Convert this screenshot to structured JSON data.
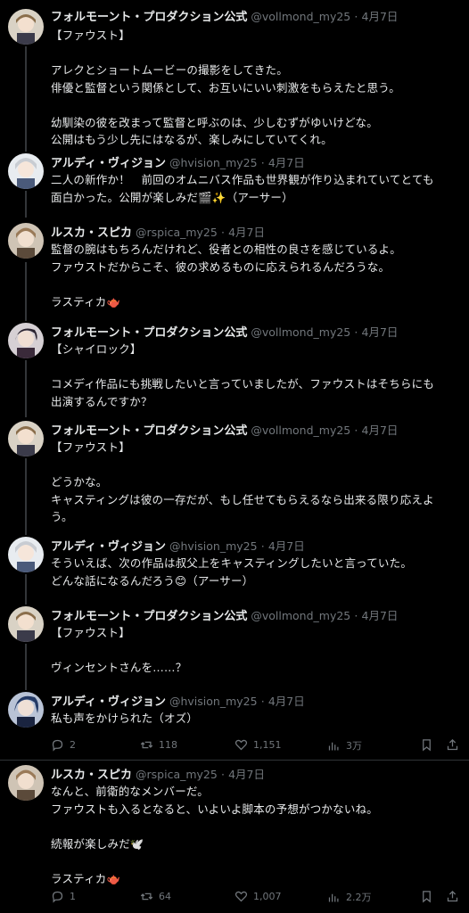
{
  "accounts": {
    "official": {
      "name": "フォルモーント・プロダクション公式",
      "handle": "@vollmond_my25"
    },
    "hvision": {
      "name": "アルディ・ヴィジョン",
      "handle": "@hvision_my25"
    },
    "rspica": {
      "name": "ルスカ・スピカ",
      "handle": "@rspica_my25"
    }
  },
  "date_sep": "·",
  "date": "4月7日",
  "tweets": [
    {
      "body": "【ファウスト】\n\nアレクとショートムービーの撮影をしてきた。\n俳優と監督という関係として、お互いにいい刺激をもらえたと思う。\n\n幼馴染の彼を改まって監督と呼ぶのは、少しむずがゆいけどな。\n公開はもう少し先にはなるが、楽しみにしていてくれ。"
    },
    {
      "body": "二人の新作か！　前回のオムニバス作品も世界観が作り込まれていてとても\n面白かった。公開が楽しみだ🎬✨（アーサー）"
    },
    {
      "body": "監督の腕はもちろんだけれど、役者との相性の良さを感じているよ。\nファウストだからこそ、彼の求めるものに応えられるんだろうな。\n\nラスティカ🫖"
    },
    {
      "body": "【シャイロック】\n\nコメディ作品にも挑戦したいと言っていましたが、ファウストはそちらにも\n出演するんですか？"
    },
    {
      "body": "【ファウスト】\n\nどうかな。\nキャスティングは彼の一存だが、もし任せてもらえるなら出来る限り応えよ\nう。"
    },
    {
      "body": "そういえば、次の作品は叔父上をキャスティングしたいと言っていた。\nどんな話になるんだろう😊（アーサー）"
    },
    {
      "body": "【ファウスト】\n\nヴィンセントさんを……？"
    },
    {
      "body": "私も声をかけられた（オズ）",
      "replies": "2",
      "reposts": "118",
      "likes": "1,151",
      "views": "3万"
    },
    {
      "body": "なんと、前衛的なメンバーだ。\nファウストも入るとなると、いよいよ脚本の予想がつかないね。\n\n続報が楽しみだ🕊️\n\nラスティカ🫖",
      "replies": "1",
      "reposts": "64",
      "likes": "1,007",
      "views": "2.2万"
    }
  ],
  "icons": [
    "reply-icon",
    "repost-icon",
    "like-icon",
    "views-icon",
    "bookmark-icon",
    "share-icon"
  ],
  "colors": {
    "background": "#000000",
    "text": "#e7e9ea",
    "secondary": "#71767b",
    "thread_line": "#333639"
  }
}
